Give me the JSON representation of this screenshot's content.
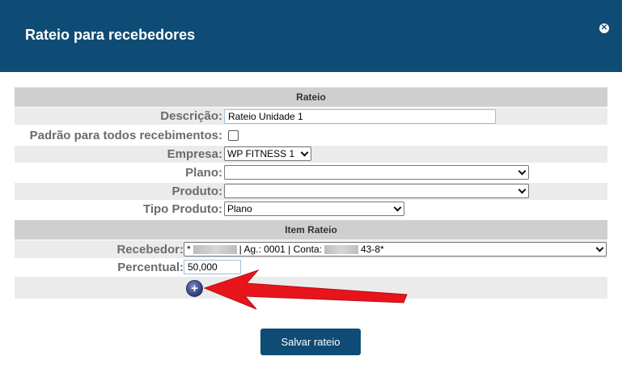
{
  "modal": {
    "title": "Rateio para recebedores",
    "close_icon": "x-circle-icon"
  },
  "rateio_section": {
    "header": "Rateio",
    "descricao": {
      "label": "Descrição:",
      "value": "Rateio Unidade 1"
    },
    "padrao": {
      "label": "Padrão para todos recebimentos:",
      "checked": false
    },
    "empresa": {
      "label": "Empresa:",
      "value": "WP FITNESS 1"
    },
    "plano": {
      "label": "Plano:",
      "value": ""
    },
    "produto": {
      "label": "Produto:",
      "value": ""
    },
    "tipo_produto": {
      "label": "Tipo Produto:",
      "value": "Plano"
    }
  },
  "item_section": {
    "header": "Item Rateio",
    "recebedor": {
      "label": "Recebedor:",
      "prefix": "*",
      "agencia_text": "| Ag.: 0001 | Conta:",
      "suffix": "43-8*"
    },
    "percentual": {
      "label": "Percentual:",
      "value": "50,000"
    },
    "add_icon": "plus-circle-icon"
  },
  "footer": {
    "save_label": "Salvar rateio"
  },
  "colors": {
    "header_bg": "#0f4c75",
    "section_header_bg": "#cfcfcf",
    "row_shade": "#ebebeb",
    "label_text": "#6b6b6b",
    "arrow": "#e8141b"
  }
}
